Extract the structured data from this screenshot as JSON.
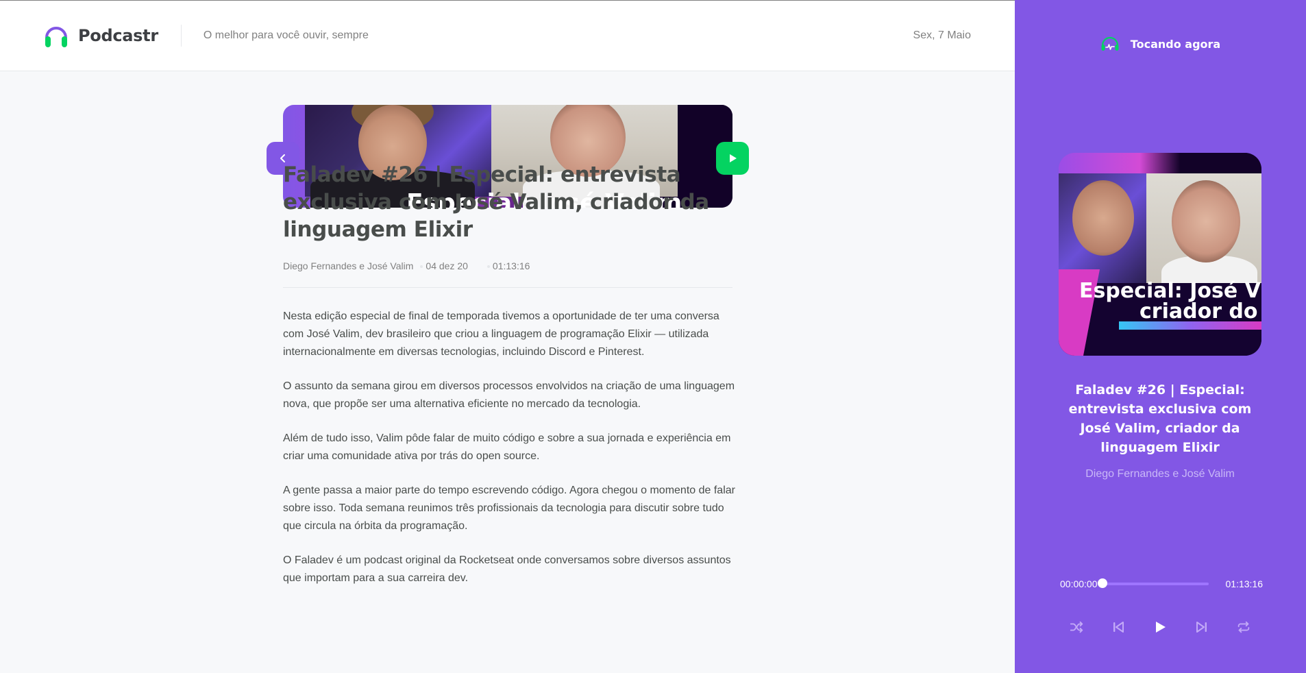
{
  "app": {
    "name": "Podcastr",
    "tagline": "O melhor para você ouvir, sempre",
    "date": "Sex, 7 Maio"
  },
  "episode": {
    "thumbnail_caption": "Especial: José Valim",
    "title": "Faladev #26 | Especial: entrevista exclusiva com José Valim, criador da linguagem Elixir",
    "members": "Diego Fernandes e José Valim",
    "published_at": "04 dez 20",
    "duration": "01:13:16",
    "description": [
      "Nesta edição especial de final de temporada tivemos a oportunidade de ter uma conversa com José Valim, dev brasileiro que criou a linguagem de programação Elixir — utilizada internacionalmente em diversas tecnologias, incluindo Discord e Pinterest.",
      "O assunto da semana girou em diversos processos envolvidos na criação de uma linguagem nova, que propõe ser uma alternativa eficiente no mercado da tecnologia.",
      "Além de tudo isso, Valim pôde falar de muito código e sobre a sua jornada e experiência em criar uma comunidade ativa por trás do open source.",
      "A gente passa a maior parte do tempo escrevendo código. Agora chegou o momento de falar sobre isso. Toda semana reunimos três profissionais da tecnologia para discutir sobre tudo que circula na órbita da programação.",
      "O Faladev é um podcast original da Rocketseat onde conversamos sobre diversos assuntos que importam para a sua carreira dev."
    ]
  },
  "player": {
    "header_label": "Tocando agora",
    "cover_caption_line1": "Especial: José V",
    "cover_caption_line2": "criador do",
    "title": "Faladev #26 | Especial: entrevista exclusiva com José Valim, criador da linguagem Elixir",
    "members": "Diego Fernandes e José Valim",
    "current_time": "00:00:00",
    "total_time": "01:13:16",
    "progress_fraction": 0.0,
    "controls": [
      "shuffle-icon",
      "play-previous-icon",
      "play-icon",
      "play-next-icon",
      "repeat-icon"
    ]
  },
  "colors": {
    "brand_purple": "#8257e5",
    "brand_green": "#04d361",
    "text_dark": "#494d4b",
    "text_muted": "#808080"
  }
}
